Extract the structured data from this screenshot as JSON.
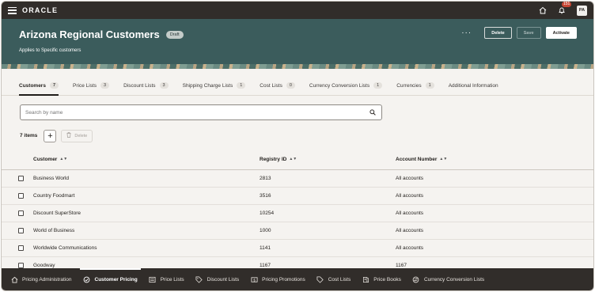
{
  "app": {
    "logo": "ORACLE",
    "notifications_count": "151",
    "user_initials": "PA"
  },
  "header": {
    "title": "Arizona Regional Customers",
    "status_badge": "Draft",
    "subtitle": "Applies to Specific customers",
    "more_label": "···",
    "delete_label": "Delete",
    "save_label": "Save",
    "activate_label": "Activate"
  },
  "tabs": [
    {
      "label": "Customers",
      "count": "7"
    },
    {
      "label": "Price Lists",
      "count": "3"
    },
    {
      "label": "Discount Lists",
      "count": "3"
    },
    {
      "label": "Shipping Charge Lists",
      "count": "1"
    },
    {
      "label": "Cost Lists",
      "count": "0"
    },
    {
      "label": "Currency Conversion Lists",
      "count": "1"
    },
    {
      "label": "Currencies",
      "count": "1"
    },
    {
      "label": "Additional Information",
      "count": ""
    }
  ],
  "search": {
    "placeholder": "Search by name"
  },
  "toolbar": {
    "item_count": "7 items",
    "add_label": "+",
    "delete_label": "Delete"
  },
  "table": {
    "columns": [
      "Customer",
      "Registry ID",
      "Account Number"
    ],
    "rows": [
      {
        "customer": "Business World",
        "registry_id": "2813",
        "account_number": "All accounts"
      },
      {
        "customer": "Country Foodmart",
        "registry_id": "3516",
        "account_number": "All accounts"
      },
      {
        "customer": "Discount SuperStore",
        "registry_id": "10254",
        "account_number": "All accounts"
      },
      {
        "customer": "World of Business",
        "registry_id": "1000",
        "account_number": "All accounts"
      },
      {
        "customer": "Worldwide Communications",
        "registry_id": "1141",
        "account_number": "All accounts"
      },
      {
        "customer": "Goodway",
        "registry_id": "1167",
        "account_number": "1167"
      }
    ]
  },
  "bottom_nav": [
    {
      "label": "Pricing Administration",
      "icon": "home-icon"
    },
    {
      "label": "Customer Pricing",
      "icon": "customer-pricing-icon"
    },
    {
      "label": "Price Lists",
      "icon": "list-icon"
    },
    {
      "label": "Discount Lists",
      "icon": "tag-icon"
    },
    {
      "label": "Pricing Promotions",
      "icon": "promotion-icon"
    },
    {
      "label": "Cost Lists",
      "icon": "cost-icon"
    },
    {
      "label": "Price Books",
      "icon": "book-icon"
    },
    {
      "label": "Currency Conversion Lists",
      "icon": "currency-icon"
    }
  ],
  "colors": {
    "topbar": "#312d2a",
    "header": "#3b5c5c",
    "page_bg": "#f5f3f0",
    "badge": "#c74634"
  }
}
